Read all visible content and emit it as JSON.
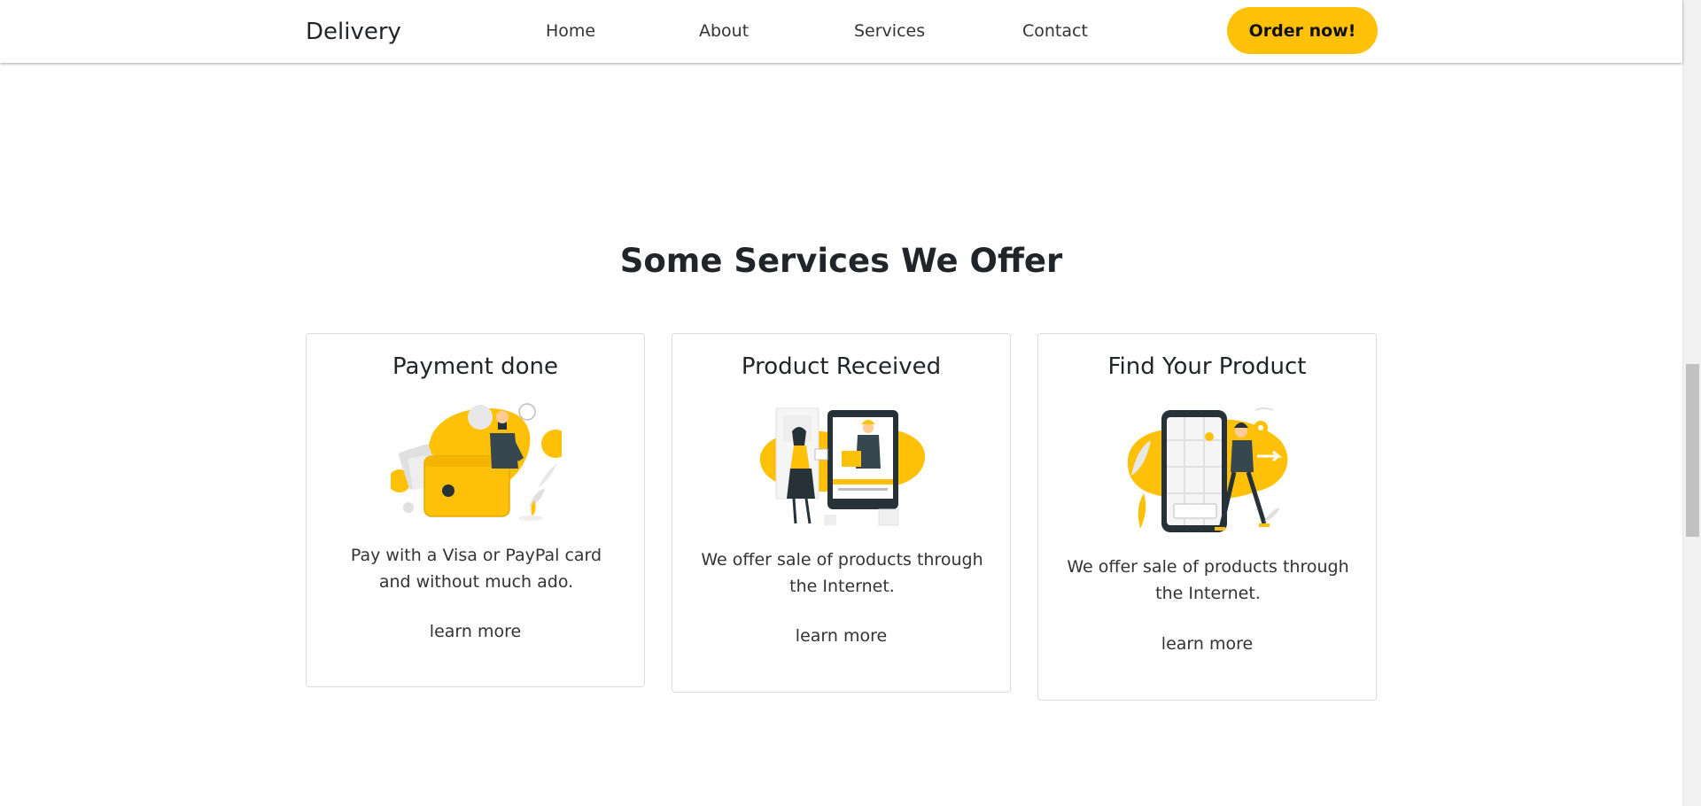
{
  "navbar": {
    "brand": "Delivery",
    "links": [
      "Home",
      "About",
      "Services",
      "Contact"
    ],
    "order_button": "Order now!"
  },
  "section": {
    "title": "Some Services We Offer",
    "cards": [
      {
        "title": "Payment done",
        "text": "Pay with a Visa or PayPal card and without much ado.",
        "link": "learn more",
        "illustration": "wallet-payment-illustration"
      },
      {
        "title": "Product Received",
        "text": "We offer sale of products through the Internet.",
        "link": "learn more",
        "illustration": "tablet-delivery-illustration"
      },
      {
        "title": "Find Your Product",
        "text": "We offer sale of products through the Internet.",
        "link": "learn more",
        "illustration": "phone-map-illustration"
      }
    ]
  },
  "colors": {
    "accent": "#FFC107",
    "text": "#212529",
    "card_border": "#dcdcdc",
    "illustration_dark": "#37474F"
  }
}
